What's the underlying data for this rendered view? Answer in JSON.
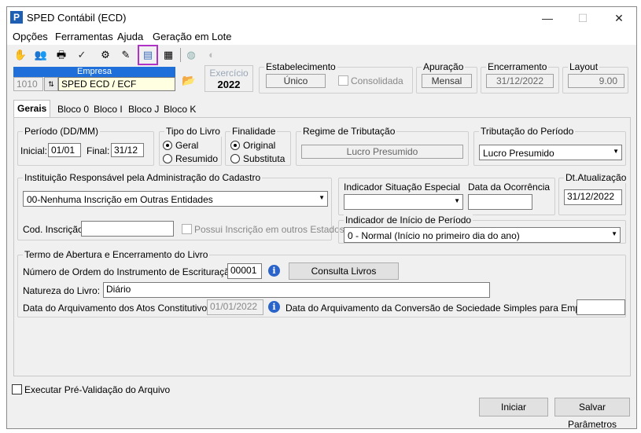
{
  "window": {
    "title": "SPED Contábil (ECD)",
    "minimize": "—",
    "maximize": "☐",
    "close": "✕"
  },
  "menu": [
    "Opções",
    "Ferramentas",
    "Ajuda",
    "Geração em Lote"
  ],
  "toolbar_icons": [
    "hand-icon",
    "people-icon",
    "printer-icon",
    "checkmark-icon",
    "tools-icon",
    "wand-icon",
    "book-icon",
    "document-icon",
    "globe-icon",
    "shield-icon"
  ],
  "empresa": {
    "header": "Empresa",
    "code": "1010",
    "name": "SPED ECD / ECF"
  },
  "exercicio": {
    "label": "Exercício",
    "value": "2022"
  },
  "estabelecimento": {
    "label": "Estabelecimento",
    "value": "Único",
    "consolidada": "Consolidada"
  },
  "apuracao": {
    "label": "Apuração",
    "value": "Mensal"
  },
  "encerramento": {
    "label": "Encerramento",
    "value": "31/12/2022"
  },
  "layout": {
    "label": "Layout",
    "value": "9.00"
  },
  "tabs": [
    "Gerais",
    "Bloco 0",
    "Bloco I",
    "Bloco J",
    "Bloco K"
  ],
  "periodo": {
    "label": "Período (DD/MM)",
    "inicial_label": "Inicial:",
    "inicial": "01/01",
    "final_label": "Final:",
    "final": "31/12"
  },
  "tipo_livro": {
    "label": "Tipo do Livro",
    "opt1": "Geral",
    "opt2": "Resumido"
  },
  "finalidade": {
    "label": "Finalidade",
    "opt1": "Original",
    "opt2": "Substituta"
  },
  "regime": {
    "label": "Regime de Tributação",
    "value": "Lucro Presumido"
  },
  "tributacao": {
    "label": "Tributação do Período",
    "value": "Lucro Presumido"
  },
  "instituicao": {
    "label": "Instituição Responsável pela Administração do Cadastro",
    "value": "00-Nenhuma Inscrição em Outras Entidades",
    "cod_label": "Cod. Inscrição",
    "cod_value": "",
    "possui": "Possui Inscrição em outros Estados"
  },
  "situacao": {
    "label": "Indicador Situação Especial",
    "value": ""
  },
  "ocorrencia": {
    "label": "Data da Ocorrência",
    "value": ""
  },
  "dt_atualizacao": {
    "label": "Dt.Atualização",
    "value": "31/12/2022"
  },
  "inicio_periodo": {
    "label": "Indicador de Início de Período",
    "value": "0 - Normal (Início no primeiro dia do ano)"
  },
  "termo": {
    "label": "Termo de Abertura e Encerramento do Livro",
    "ordem_label": "Número de Ordem do Instrumento de Escrituração:",
    "ordem_value": "00001",
    "consulta_button": "Consulta Livros Anteriores",
    "natureza_label": "Natureza do Livro:",
    "natureza_value": "Diário",
    "arquivamento_label": "Data do Arquivamento dos Atos Constitutivos:",
    "arquivamento_value": "01/01/2022",
    "conversao_label": "Data do Arquivamento da Conversão de Sociedade Simples para Empresária:",
    "conversao_value": ""
  },
  "footer": {
    "prevalidacao": "Executar Pré-Validação do Arquivo",
    "iniciar": "Iniciar",
    "salvar": "Salvar Parâmetros"
  }
}
